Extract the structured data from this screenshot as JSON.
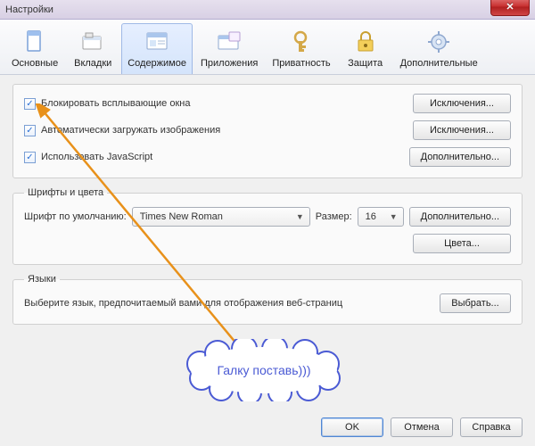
{
  "window": {
    "title": "Настройки"
  },
  "tabs": {
    "main": "Основные",
    "tabs": "Вкладки",
    "content": "Содержимое",
    "apps": "Приложения",
    "privacy": "Приватность",
    "security": "Защита",
    "advanced": "Дополнительные"
  },
  "section1": {
    "popup": "Блокировать всплывающие окна",
    "images": "Автоматически загружать изображения",
    "js": "Использовать JavaScript",
    "exceptions": "Исключения...",
    "more": "Дополнительно..."
  },
  "fonts": {
    "legend": "Шрифты и цвета",
    "default_label": "Шрифт по умолчанию:",
    "font": "Times New Roman",
    "size_label": "Размер:",
    "size": "16",
    "more": "Дополнительно...",
    "colors": "Цвета..."
  },
  "langs": {
    "legend": "Языки",
    "desc": "Выберите язык, предпочитаемый вами для отображения веб-страниц",
    "choose": "Выбрать..."
  },
  "footer": {
    "ok": "OK",
    "cancel": "Отмена",
    "help": "Справка"
  },
  "annotation": {
    "text": "Галку поставь)))"
  }
}
